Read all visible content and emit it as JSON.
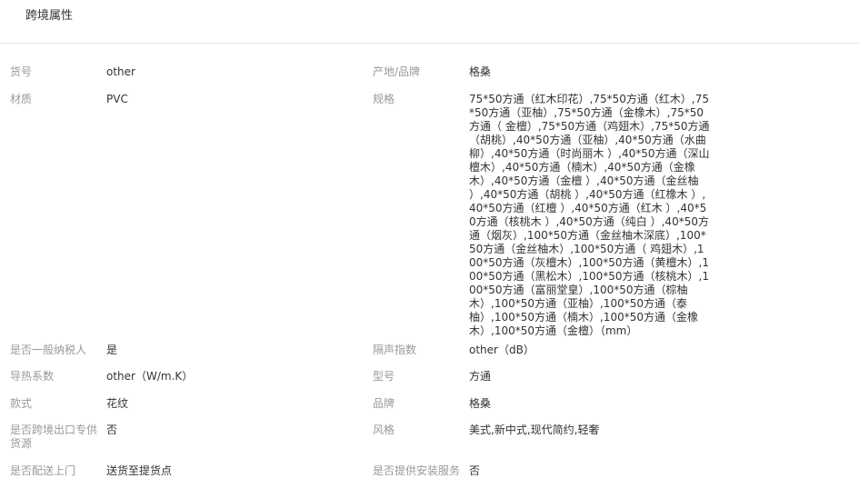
{
  "section_title": "跨境属性",
  "rows": [
    {
      "left": {
        "label": "货号",
        "value": "other"
      },
      "right": {
        "label": "产地/品牌",
        "value": "格桑"
      }
    },
    {
      "left": {
        "label": "材质",
        "value": "PVC"
      },
      "right": {
        "label": "规格",
        "value": "75*50方通（红木印花）,75*50方通（红木）,75*50方通（亚柚）,75*50方通（金橡木）,75*50方通（ 金檀）,75*50方通（鸡翅木）,75*50方通（胡桃）,40*50方通（亚柚）,40*50方通（水曲柳）,40*50方通（时尚丽木 ）,40*50方通（深山檀木）,40*50方通（楠木）,40*50方通（金橡木）,40*50方通（金檀 ）,40*50方通（金丝柚 ）,40*50方通（胡桃 ）,40*50方通（红橡木 ）,40*50方通（红檀 ）,40*50方通（红木 ）,40*50方通（核桃木 ）,40*50方通（纯白 ）,40*50方通（烟灰）,100*50方通（金丝柚木深底）,100*50方通（金丝柚木）,100*50方通（ 鸡翅木）,100*50方通（灰檀木）,100*50方通（黄檀木）,100*50方通（黑松木）,100*50方通（核桃木）,100*50方通（富丽堂皇）,100*50方通（棕柚木）,100*50方通（亚柚）,100*50方通（泰柚）,100*50方通（楠木）,100*50方通（金橡木）,100*50方通（金檀）（mm）"
      }
    },
    {
      "left": {
        "label": "是否一般纳税人",
        "value": "是"
      },
      "right": {
        "label": "隔声指数",
        "value": "other（dB）"
      }
    },
    {
      "left": {
        "label": "导热系数",
        "value": "other（W/m.K）"
      },
      "right": {
        "label": "型号",
        "value": "方通"
      }
    },
    {
      "left": {
        "label": "款式",
        "value": "花纹"
      },
      "right": {
        "label": "品牌",
        "value": "格桑"
      }
    },
    {
      "left": {
        "label": "是否跨境出口专供货源",
        "value": "否"
      },
      "right": {
        "label": "风格",
        "value": "美式,新中式,现代简约,轻奢"
      }
    },
    {
      "left": {
        "label": "是否配送上门",
        "value": "送货至提货点"
      },
      "right": {
        "label": "是否提供安装服务",
        "value": "否"
      }
    }
  ]
}
